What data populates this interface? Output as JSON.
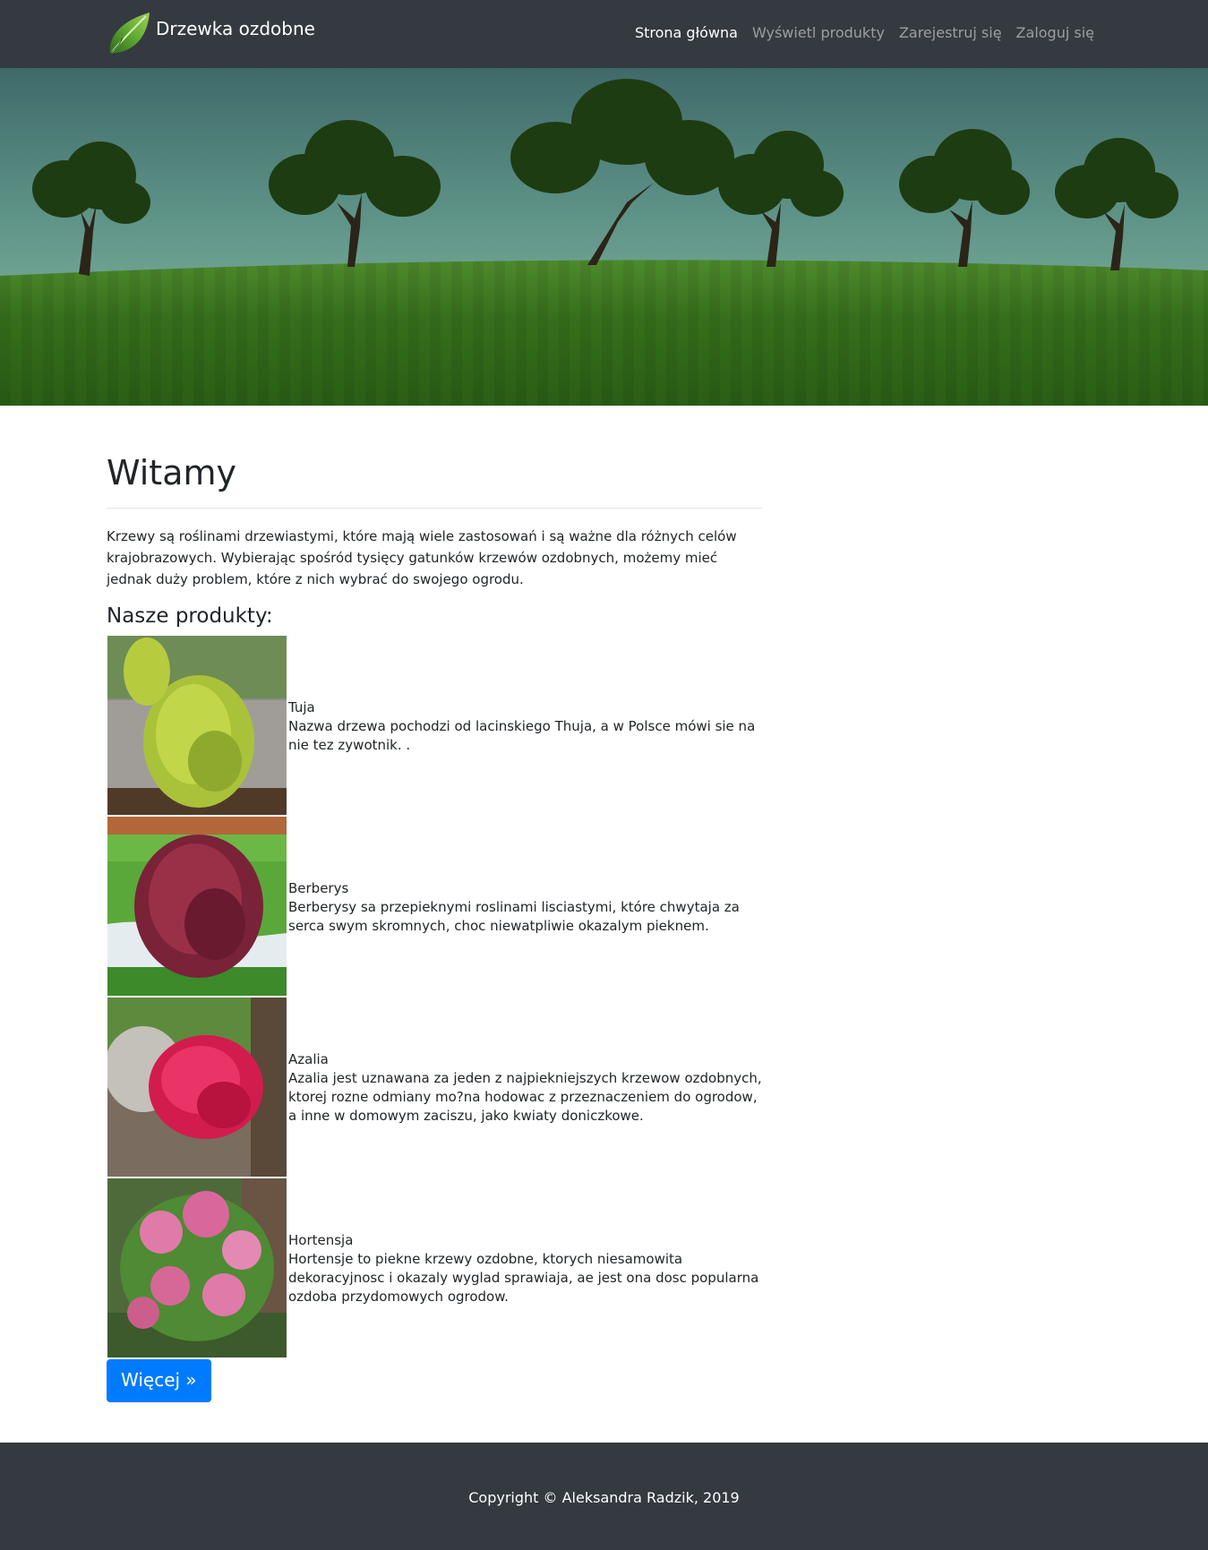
{
  "navbar": {
    "brand": "Drzewka ozdobne",
    "brand_icon": "leaf-icon",
    "links": [
      {
        "label": "Strona główna",
        "active": true
      },
      {
        "label": "Wyświetl produkty",
        "active": false
      },
      {
        "label": "Zarejestruj się",
        "active": false
      },
      {
        "label": "Zaloguj się",
        "active": false
      }
    ]
  },
  "main": {
    "title": "Witamy",
    "intro": "Krzewy są roślinami drzewiastymi, które mają wiele zastosowań i są ważne dla różnych celów krajobrazowych. Wybierając spośród tysięcy gatunków krzewów ozdobnych, możemy mieć jednak duży problem, które z nich wybrać do swojego ogrodu.",
    "products_heading": "Nasze produkty:",
    "products": [
      {
        "name": "Tuja",
        "description": "Nazwa drzewa pochodzi od lacinskiego Thuja, a w Polsce mówi sie na nie tez zywotnik. ."
      },
      {
        "name": "Berberys",
        "description": "Berberysy sa przepieknymi roslinami lisciastymi, które chwytaja za serca swym skromnych, choc niewatpliwie okazalym pieknem."
      },
      {
        "name": "Azalia",
        "description": "Azalia jest uznawana za jeden z najpiekniejszych krzewow ozdobnych, ktorej rozne odmiany mo?na hodowac z przeznaczeniem do ogrodow, a inne w domowym zaciszu, jako kwiaty doniczkowe."
      },
      {
        "name": "Hortensja",
        "description": "Hortensje to piekne krzewy ozdobne, ktorych niesamowita dekoracyjnosc i okazaly wyglad sprawiaja, ae jest ona dosc popularna ozdoba przydomowych ogrodow."
      }
    ],
    "more_button": "Więcej »"
  },
  "footer": {
    "copyright": "Copyright © Aleksandra Radzik, 2019"
  },
  "colors": {
    "navbar_bg": "#343a40",
    "primary": "#007bff",
    "footer_bg": "#343a40"
  }
}
